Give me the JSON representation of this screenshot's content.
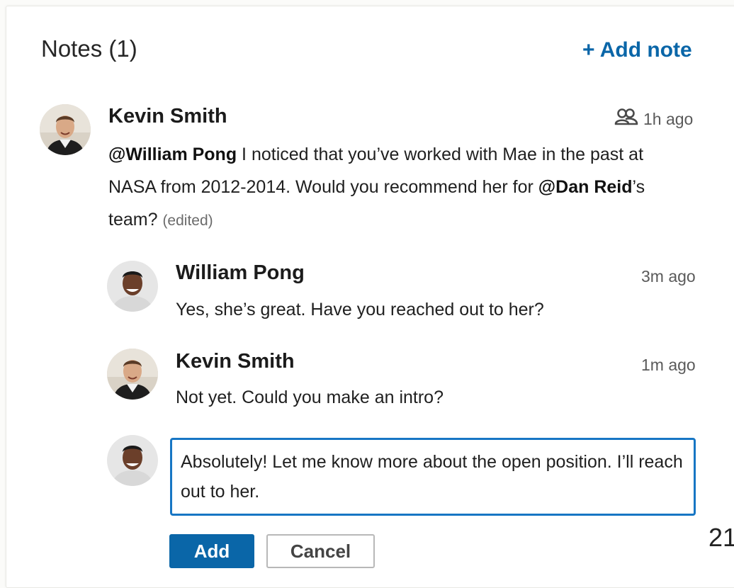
{
  "header": {
    "title": "Notes (1)",
    "add_note_label": "+ Add note"
  },
  "note": {
    "author": "Kevin Smith",
    "visibility_icon": "group-icon",
    "time": "1h ago",
    "mention_1": "@William Pong",
    "text_1": " I noticed that you’ve worked with Mae in the past at NASA from 2012-2014. Would you recommend her for ",
    "mention_2": "@Dan Reid",
    "text_2": "’s team? ",
    "edited_label": "(edited)"
  },
  "replies": [
    {
      "author": "William Pong",
      "time": "3m ago",
      "text": "Yes, she’s great. Have you reached out to her?"
    },
    {
      "author": "Kevin Smith",
      "time": "1m ago",
      "text": "Not yet. Could you make an intro?"
    }
  ],
  "compose": {
    "value": "Absolutely! Let me know more about the open position. I’ll reach out to her.",
    "add_label": "Add",
    "cancel_label": "Cancel"
  },
  "page_number": "21",
  "colors": {
    "accent": "#0a66a8",
    "focus_border": "#1776c4"
  }
}
